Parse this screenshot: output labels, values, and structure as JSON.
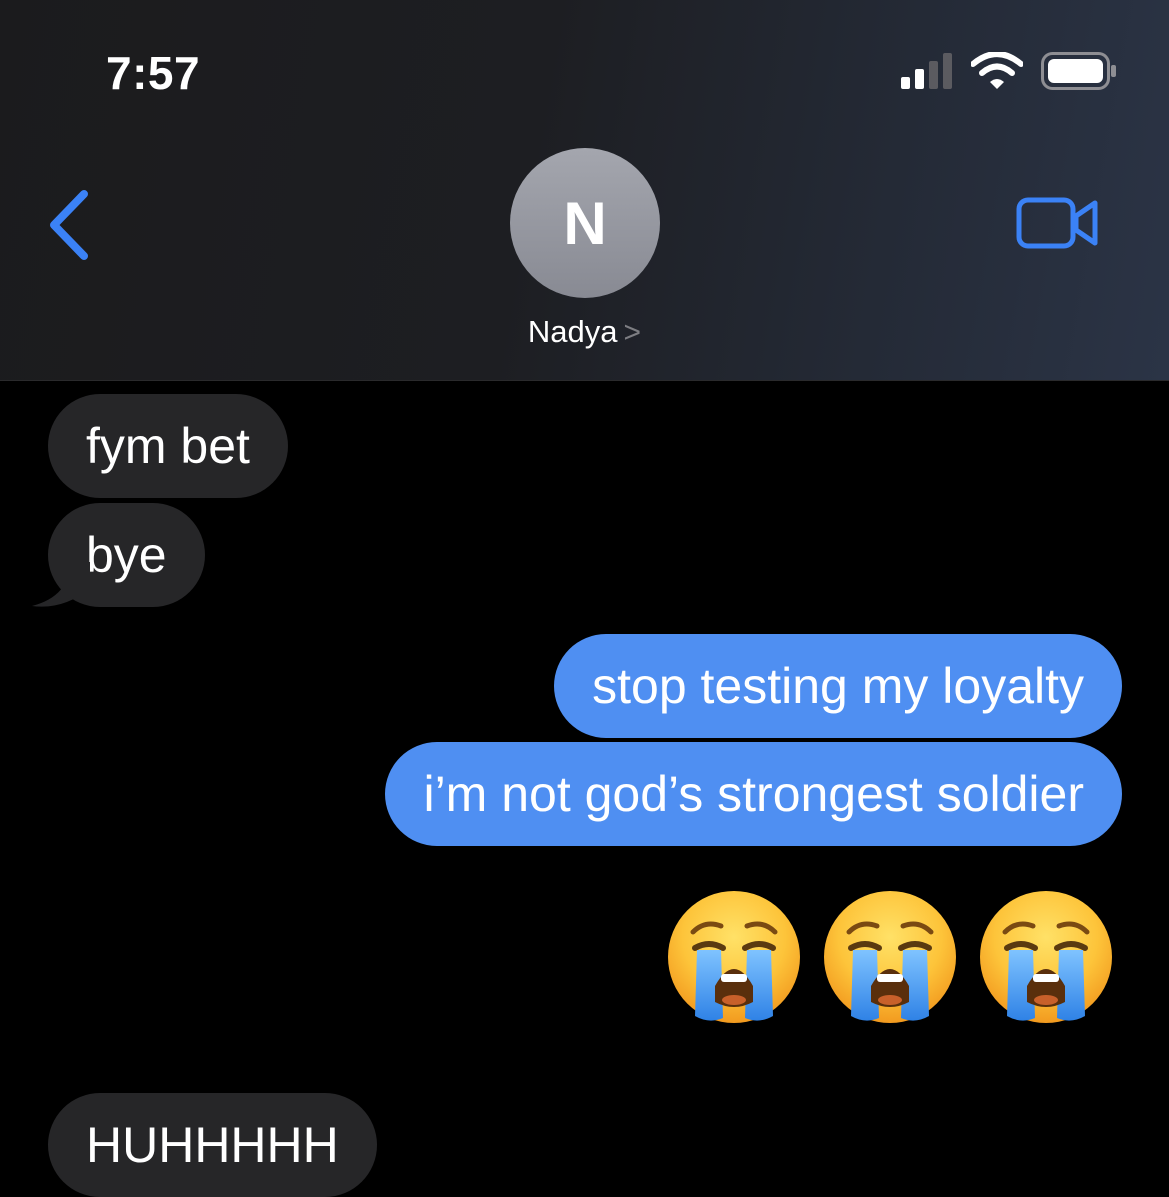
{
  "status_bar": {
    "time": "7:57",
    "icons": [
      "cellular-signal-icon",
      "wifi-icon",
      "battery-icon"
    ]
  },
  "nav": {
    "back_icon": "chevron-left-icon",
    "video_icon": "video-camera-icon",
    "contact_initial": "N",
    "contact_name": "Nadya",
    "contact_chevron": ">"
  },
  "messages": [
    {
      "direction": "incoming",
      "text": "fym bet"
    },
    {
      "direction": "incoming",
      "text": "bye"
    },
    {
      "direction": "outgoing",
      "text": "stop testing my loyalty"
    },
    {
      "direction": "outgoing",
      "text": "i’m not god’s strongest soldier"
    },
    {
      "direction": "outgoing",
      "emoji": [
        "loudly-crying-face-emoji",
        "loudly-crying-face-emoji",
        "loudly-crying-face-emoji"
      ]
    },
    {
      "direction": "incoming",
      "text": "HUHHHHH"
    }
  ],
  "colors": {
    "accent": "#3b82f6",
    "outgoing_bubble": "#4f8ff2",
    "incoming_bubble": "#262628",
    "background": "#000000"
  }
}
